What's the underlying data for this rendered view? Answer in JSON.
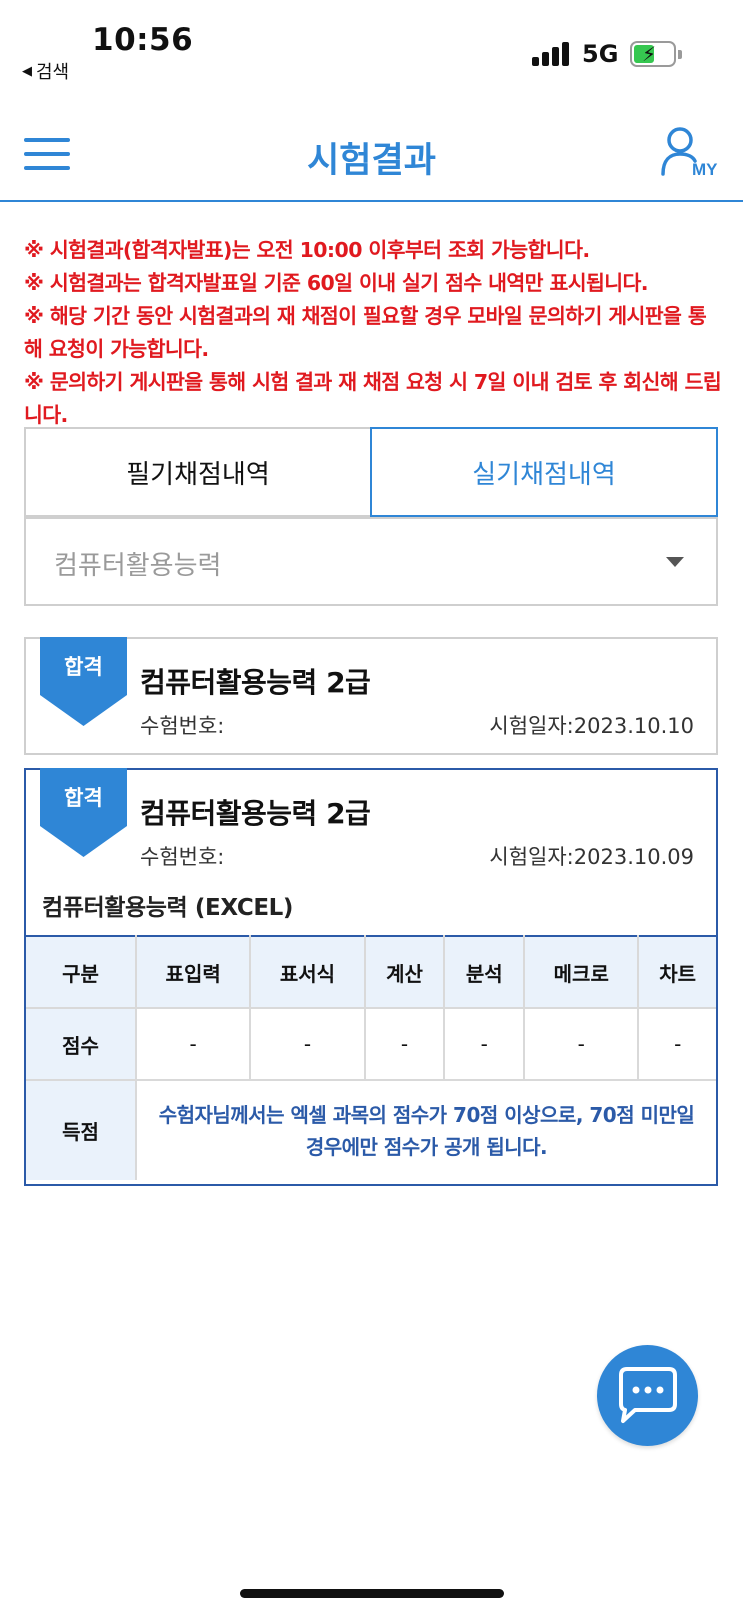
{
  "status_bar": {
    "time": "10:56",
    "back_label": "검색",
    "network": "5G"
  },
  "header": {
    "title": "시험결과",
    "my_label": "MY",
    "menu_icon": "hamburger-menu-icon",
    "my_icon": "user-icon"
  },
  "notices": [
    "※ 시험결과(합격자발표)는 오전 10:00 이후부터 조회 가능합니다.",
    "※ 시험결과는 합격자발표일 기준 60일 이내 실기 점수 내역만 표시됩니다.",
    "※ 해당 기간 동안 시험결과의 재 채점이 필요할 경우 모바일 문의하기 게시판을 통해 요청이 가능합니다.",
    "※ 문의하기 게시판을 통해 시험 결과 재 채점 요청 시 7일 이내 검토 후 회신해 드립니다."
  ],
  "tabs": {
    "written": "필기채점내역",
    "practical": "실기채점내역",
    "active": "practical"
  },
  "select": {
    "value": "컴퓨터활용능력"
  },
  "results": [
    {
      "badge": "합격",
      "title": "컴퓨터활용능력 2급",
      "exam_number_label": "수험번호:",
      "exam_date_label": "시험일자:2023.10.10"
    },
    {
      "badge": "합격",
      "title": "컴퓨터활용능력 2급",
      "exam_number_label": "수험번호:",
      "exam_date_label": "시험일자:2023.10.09",
      "subject": "컴퓨터활용능력 (EXCEL)",
      "table": {
        "header_label": "구분",
        "columns": [
          "표입력",
          "표서식",
          "계산",
          "분석",
          "메크로",
          "차트"
        ],
        "score_label": "점수",
        "scores": [
          "-",
          "-",
          "-",
          "-",
          "-",
          "-"
        ],
        "gain_label": "득점",
        "gain_note": "수험자님께서는 엑셀 과목의 점수가 70점 이상으로, 70점 미만일 경우에만 점수가 공개 됩니다."
      }
    }
  ],
  "colors": {
    "accent": "#2f86d6",
    "notice": "#e0191f",
    "card_border": "#2b5aa8",
    "table_header_bg": "#eaf2fb"
  }
}
